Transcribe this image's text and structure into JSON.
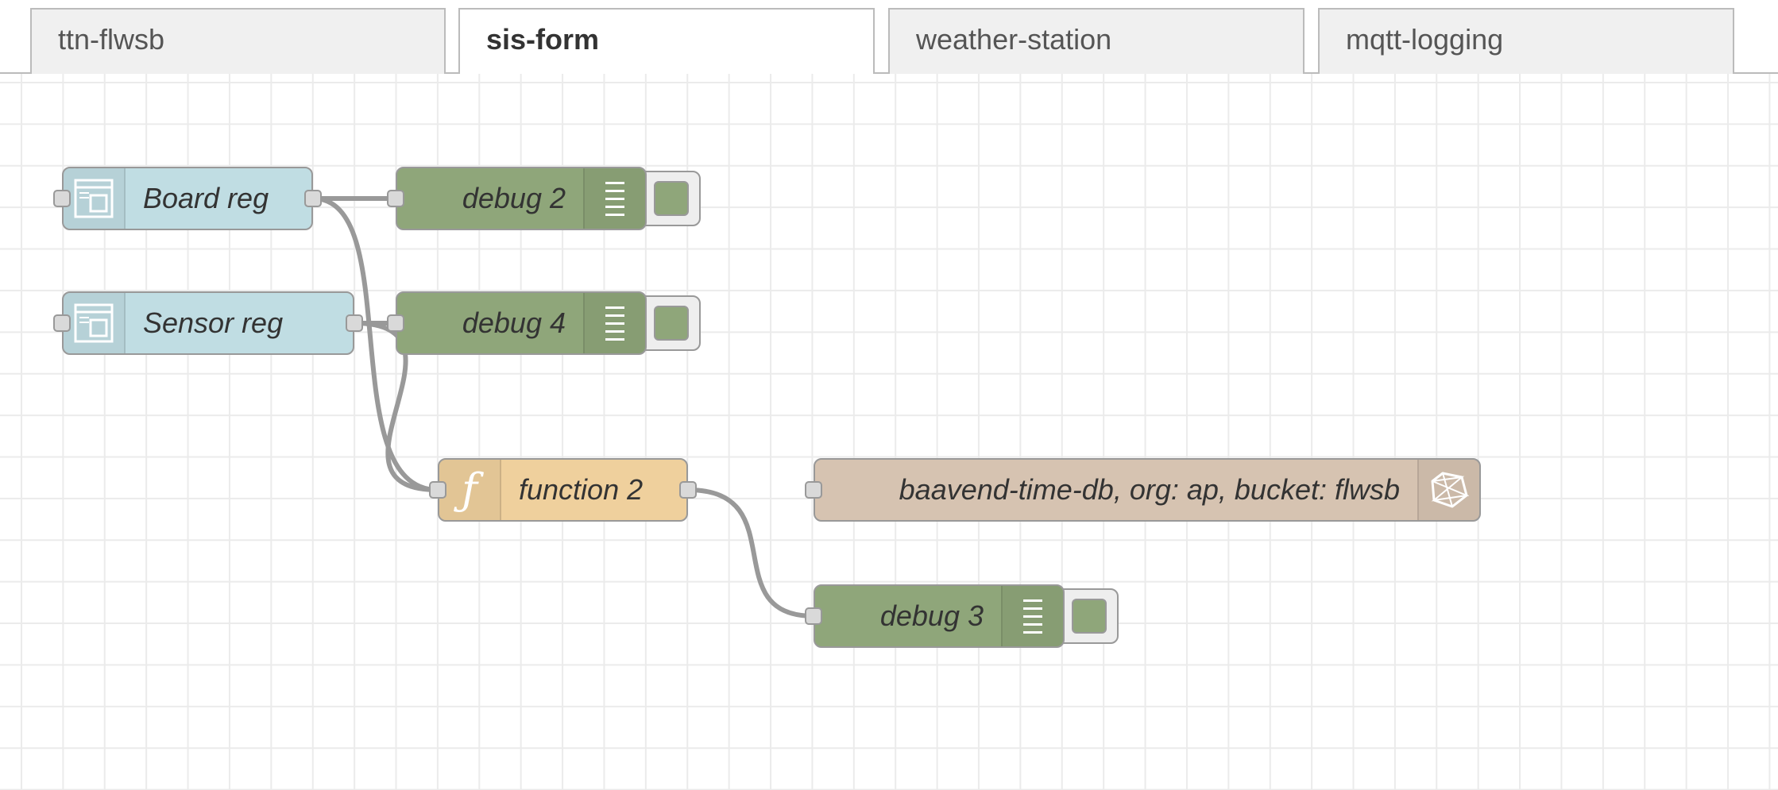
{
  "tabs": [
    {
      "label": "ttn-flwsb",
      "active": false
    },
    {
      "label": "sis-form",
      "active": true
    },
    {
      "label": "weather-station",
      "active": false
    },
    {
      "label": "mqtt-logging",
      "active": false
    }
  ],
  "nodes": {
    "board_reg": {
      "label": "Board reg",
      "type": "ui_template",
      "color": "#c0dde3",
      "icon": "template-icon"
    },
    "sensor_reg": {
      "label": "Sensor reg",
      "type": "ui_template",
      "color": "#c0dde3",
      "icon": "template-icon"
    },
    "debug2": {
      "label": "debug 2",
      "type": "debug",
      "color": "#8fa67a",
      "icon": "debug-list-icon"
    },
    "debug4": {
      "label": "debug 4",
      "type": "debug",
      "color": "#8fa67a",
      "icon": "debug-list-icon"
    },
    "function2": {
      "label": "function 2",
      "type": "function",
      "color": "#efd09d",
      "icon": "function-icon"
    },
    "influx": {
      "label": "baavend-time-db, org: ap, bucket: flwsb",
      "type": "influxdb out",
      "color": "#d6c3b1",
      "icon": "influxdb-icon"
    },
    "debug3": {
      "label": "debug 3",
      "type": "debug",
      "color": "#8fa67a",
      "icon": "debug-list-icon"
    }
  },
  "wires": [
    {
      "from": "board_reg",
      "to": "debug2"
    },
    {
      "from": "board_reg",
      "to": "function2"
    },
    {
      "from": "sensor_reg",
      "to": "debug4"
    },
    {
      "from": "sensor_reg",
      "to": "function2"
    },
    {
      "from": "function2",
      "to": "debug3"
    }
  ],
  "colors": {
    "wire": "#999999",
    "grid": "#ebebeb",
    "port": "#d9d9d9"
  }
}
